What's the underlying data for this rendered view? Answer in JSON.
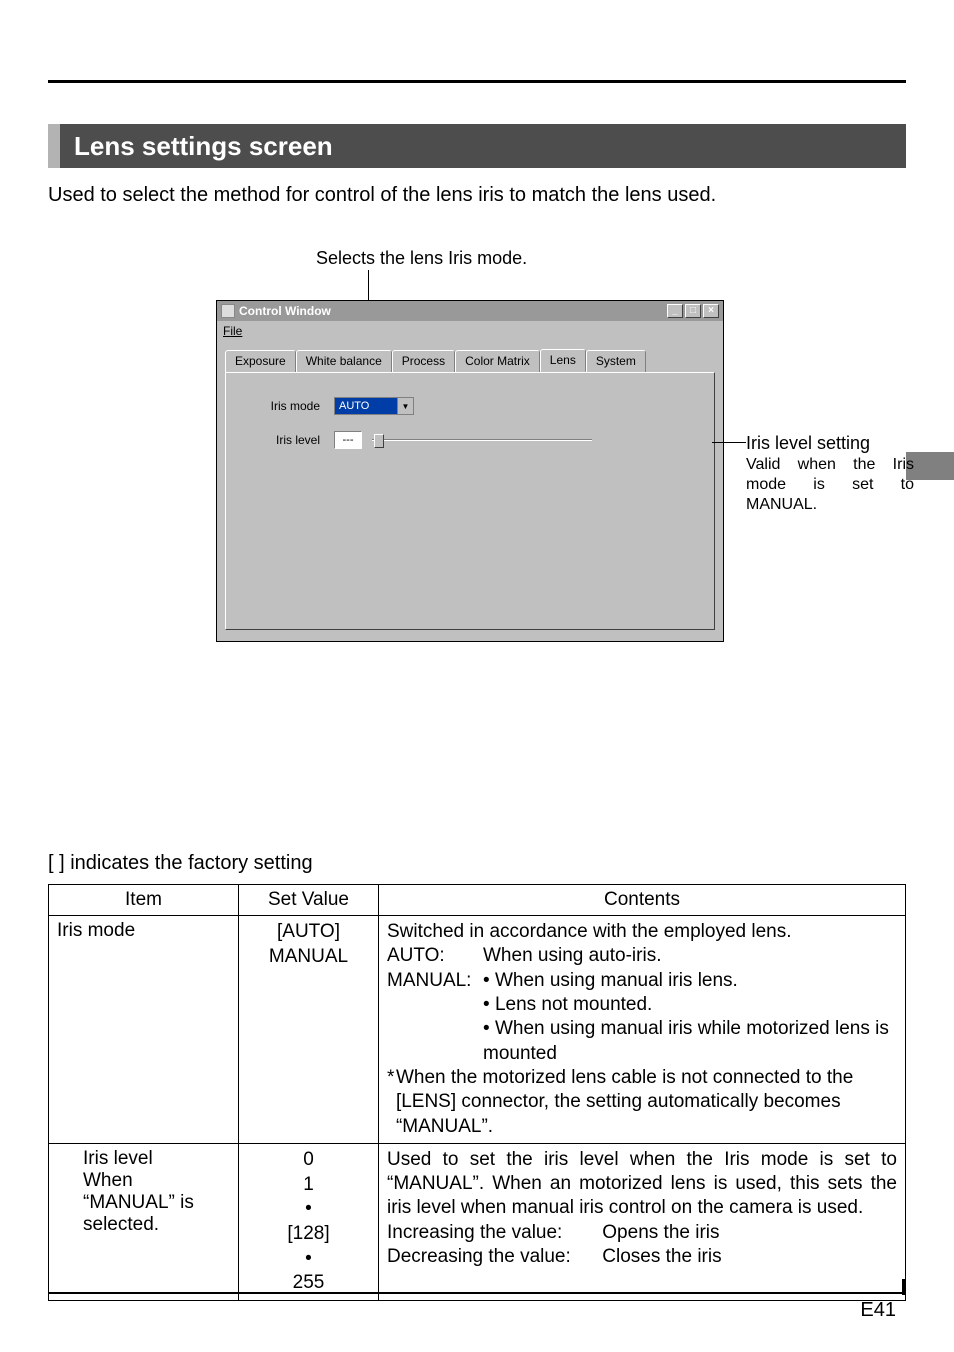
{
  "page": {
    "title": "Lens settings screen",
    "intro": "Used to select the method for control of the lens iris to match the lens used.",
    "iris_mode_caption": "Selects the lens Iris mode.",
    "factory_note": "[  ] indicates the factory setting",
    "page_number": "E41"
  },
  "callout": {
    "title": "Iris level setting",
    "line1": "Valid when the Iris",
    "line2": "mode is set to",
    "line3": "MANUAL."
  },
  "control_window": {
    "title": "Control Window",
    "menu_file": "File",
    "tabs": [
      "Exposure",
      "White balance",
      "Process",
      "Color Matrix",
      "Lens",
      "System"
    ],
    "active_tab": "Lens",
    "iris_mode_label": "Iris mode",
    "iris_mode_value": "AUTO",
    "iris_level_label": "Iris level",
    "iris_level_value": "---",
    "btn_min": "_",
    "btn_max": "□",
    "btn_close": "×",
    "dropdown_arrow": "▼"
  },
  "table": {
    "headers": {
      "item": "Item",
      "set_value": "Set Value",
      "contents": "Contents"
    },
    "rows": [
      {
        "item": "Iris mode",
        "set_value_lines": [
          "[AUTO]",
          "MANUAL"
        ],
        "contents": {
          "lead": "Switched in accordance with the employed lens.",
          "auto_label": "AUTO:",
          "auto_text": "When using auto-iris.",
          "manual_label": "MANUAL:",
          "manual_bullets": [
            "When using manual iris lens.",
            "Lens not mounted.",
            "When using manual iris while motorized lens is mounted"
          ],
          "star_lead": "*",
          "star_text": "When the motorized lens cable is not connected to the [LENS] connector, the setting automatically becomes “MANUAL”."
        }
      },
      {
        "item_lines": [
          "Iris level",
          "When",
          "“MANUAL” is",
          "selected."
        ],
        "set_value_lines": [
          "0",
          "1",
          "•",
          "[128]",
          "•",
          "255"
        ],
        "contents": {
          "para": "Used to set the iris level when the Iris mode is set to “MANUAL”. When an motorized  lens is used, this sets the iris level when manual iris control on the camera is used.",
          "inc_label": "Increasing the value:",
          "inc_text": "Opens the iris",
          "dec_label": "Decreasing the value:",
          "dec_text": "Closes the iris"
        }
      }
    ]
  }
}
